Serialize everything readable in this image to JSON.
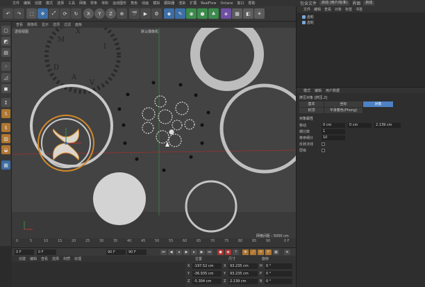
{
  "menu": {
    "items": [
      "文件",
      "编辑",
      "创建",
      "模式",
      "选择",
      "工具",
      "网格",
      "样条",
      "体积",
      "运动图形",
      "角色",
      "动画",
      "模拟",
      "跟踪器",
      "渲染",
      "扩展",
      "窗口",
      "帮助"
    ],
    "extra_items": [
      "RealFlow",
      "Octane",
      "窗口",
      "帮助"
    ]
  },
  "right_top": {
    "layout_label": "包含文件",
    "layout_value": "启动 (用户/标准)",
    "interface_label": "界面",
    "interface_value": "启动"
  },
  "toolbar": {
    "axis_buttons": [
      "X",
      "Y",
      "Z"
    ]
  },
  "viewport": {
    "menu": [
      "查看",
      "摄像机",
      "显示",
      "选项",
      "过滤",
      "面板"
    ],
    "view_name": "透视视图",
    "camera_label": "默认摄像机",
    "grid_spacing": "网格间距 : 5000 cm"
  },
  "timeline": {
    "ticks": [
      "0",
      "5",
      "10",
      "15",
      "20",
      "25",
      "30",
      "35",
      "40",
      "45",
      "50",
      "55",
      "60",
      "65",
      "70",
      "75",
      "80",
      "85",
      "90"
    ],
    "end_frame_right": "0 F"
  },
  "playback": {
    "current_frame": "0 F",
    "start_frame": "0 F",
    "end_frame_a": "90 F",
    "end_frame_b": "90 F"
  },
  "material_manager": {
    "menu": [
      "创建",
      "编辑",
      "查看",
      "选择",
      "材质",
      "纹理"
    ]
  },
  "coords": {
    "headers": [
      "位置",
      "尺寸",
      "旋转"
    ],
    "rows": [
      {
        "axis": "X",
        "pos": "-197.52 cm",
        "size_axis": "X",
        "size": "93.235 cm",
        "rot_axis": "H",
        "rot": "0 °"
      },
      {
        "axis": "Y",
        "pos": "-36.935 cm",
        "size_axis": "Y",
        "size": "93.235 cm",
        "rot_axis": "P",
        "rot": "0 °"
      },
      {
        "axis": "Z",
        "pos": "-5.304 cm",
        "size_axis": "Z",
        "size": "2.139 cm",
        "rot_axis": "B",
        "rot": "0 °"
      }
    ]
  },
  "object_manager": {
    "menu": [
      "文件",
      "编辑",
      "查看",
      "对象",
      "标签",
      "书签"
    ],
    "objects": [
      "齿轮",
      "齿轮"
    ]
  },
  "attributes": {
    "menu": [
      "模式",
      "编辑",
      "用户数据"
    ],
    "object_name": "挤压对象 [挤压.2]",
    "tabs_row1": [
      "基本",
      "坐标",
      "对象"
    ],
    "tabs_row2": [
      "封顶",
      "平滑着色(Phong)"
    ],
    "section": "对象属性",
    "move_label": "移动",
    "move_values": [
      "0 cm",
      "0 cm",
      "2.139 cm"
    ],
    "subdiv_label": "细分数",
    "subdiv_value": "1",
    "isoparm_label": "等参细分",
    "isoparm_value": "10",
    "flip_normals_label": "反转法线",
    "hierarchical_label": "层级"
  }
}
